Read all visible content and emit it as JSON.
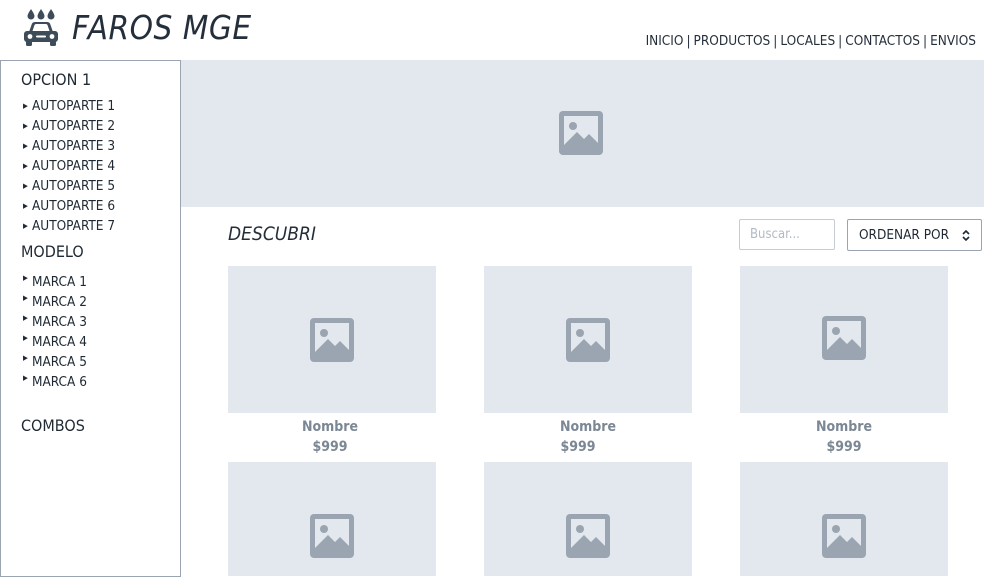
{
  "brand": {
    "name": "FAROS MGE",
    "icon": "car-wash-icon"
  },
  "nav": {
    "items": [
      "INICIO",
      "PRODUCTOS",
      "LOCALES",
      "CONTACTOS",
      "ENVIOS"
    ],
    "separator": "|"
  },
  "sidebar": {
    "opcion_heading": "OPCION 1",
    "autopartes": [
      "AUTOPARTE 1",
      "AUTOPARTE 2",
      "AUTOPARTE 3",
      "AUTOPARTE 4",
      "AUTOPARTE 5",
      "AUTOPARTE 6",
      "AUTOPARTE 7"
    ],
    "modelo_heading": "MODELO",
    "marcas": [
      "MARCA 1",
      "MARCA 2",
      "MARCA 3",
      "MARCA 4",
      "MARCA 5",
      "MARCA 6"
    ],
    "combos_heading": "COMBOS",
    "bullet_icon": "caret-right-icon"
  },
  "hero": {
    "icon": "image-placeholder-icon"
  },
  "catalog": {
    "title": "DESCUBRI",
    "search_placeholder": "Buscar...",
    "sort_label": "ORDENAR POR",
    "sort_icon": "up-down-chevron-icon",
    "products": [
      {
        "name": "Nombre",
        "price": "$999"
      },
      {
        "name": "Nombre",
        "price": "$999"
      },
      {
        "name": "Nombre",
        "price": "$999"
      },
      {
        "name": "",
        "price": ""
      },
      {
        "name": "",
        "price": ""
      },
      {
        "name": "",
        "price": ""
      }
    ]
  },
  "colors": {
    "text_dark": "#252f3b",
    "placeholder_bg": "#e3e7ee",
    "placeholder_icon": "#9aa5b1",
    "muted_text": "#7b8794",
    "border": "#9aa5b1"
  }
}
